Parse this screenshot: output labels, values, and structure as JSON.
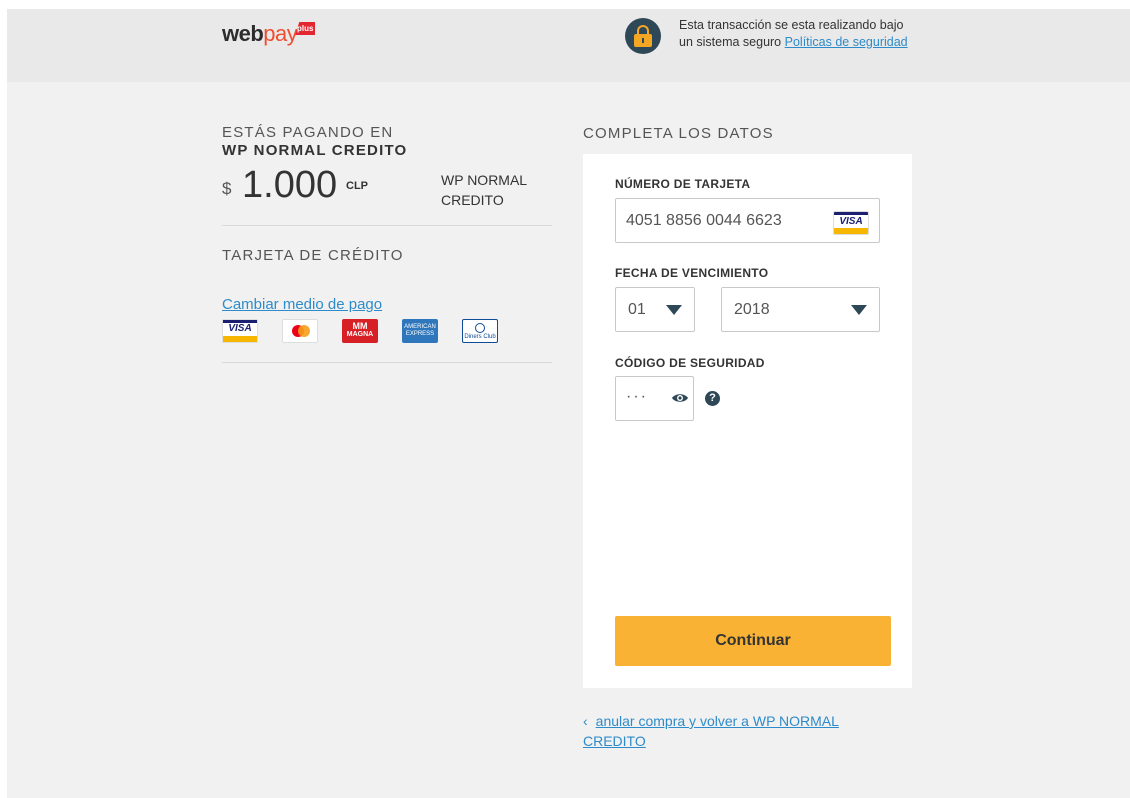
{
  "header": {
    "logo": {
      "text_main": "web",
      "text_accent": "pay",
      "badge": "plus"
    },
    "secure_text": "Esta transacción se esta realizando bajo un sistema seguro",
    "security_link": "Políticas de seguridad",
    "colors": {
      "lock_bg": "#2f4858",
      "lock_accent": "#f5a623",
      "link": "#2e8bc9"
    }
  },
  "summary": {
    "paying_label": "ESTÁS PAGANDO EN",
    "merchant": "WP NORMAL CREDITO",
    "currency_symbol": "$",
    "amount": "1.000",
    "currency_code": "CLP",
    "merchant_short": "WP NORMAL CREDITO",
    "card_type": "TARJETA DE CRÉDITO",
    "change_method_link": "Cambiar medio de pago",
    "brands": [
      {
        "name": "visa-icon",
        "label": "VISA"
      },
      {
        "name": "mastercard-icon",
        "label": "mastercard"
      },
      {
        "name": "magna-icon",
        "label": "MAGNA"
      },
      {
        "name": "amex-icon",
        "label": "AMERICAN EXPRESS"
      },
      {
        "name": "diners-icon",
        "label": "Diners Club INTERNATIONAL"
      }
    ]
  },
  "form": {
    "title": "COMPLETA LOS DATOS",
    "card_number_label": "NÚMERO DE TARJETA",
    "card_number_value": "4051 8856 0044 6623",
    "card_brand": "VISA",
    "expiry_label": "FECHA DE VENCIMIENTO",
    "expiry_month": "01",
    "expiry_year": "2018",
    "cvv_label": "CÓDIGO DE SEGURIDAD",
    "cvv_value": "···",
    "help_symbol": "?",
    "continue_label": "Continuar",
    "colors": {
      "button": "#f9b233"
    }
  },
  "footer": {
    "chevron": "‹",
    "cancel_link": "anular compra y volver a WP NORMAL CREDITO"
  }
}
